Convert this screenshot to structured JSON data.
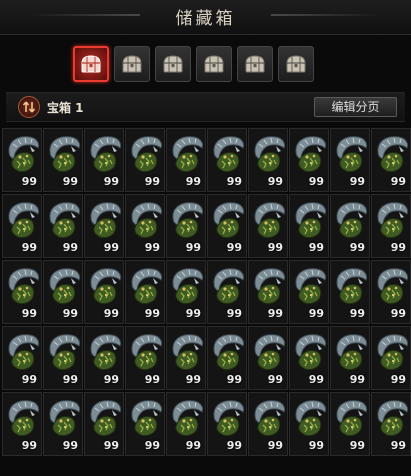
{
  "window": {
    "title": "储藏箱"
  },
  "tabs": [
    {
      "icon": "chest-icon",
      "active": true
    },
    {
      "icon": "chest-icon",
      "active": false
    },
    {
      "icon": "chest-icon",
      "active": false
    },
    {
      "icon": "chest-icon",
      "active": false
    },
    {
      "icon": "chest-icon",
      "active": false
    },
    {
      "icon": "chest-icon",
      "active": false
    }
  ],
  "bar": {
    "sort_icon": "sort-arrows-icon",
    "page_label": "宝箱 1",
    "edit_button": "编辑分页"
  },
  "grid": {
    "columns": 10,
    "rows": 5,
    "item_icon": "monster-head-icon",
    "quantities": [
      "99",
      "99",
      "99",
      "99",
      "99",
      "99",
      "99",
      "99",
      "99",
      "99",
      "99",
      "99",
      "99",
      "99",
      "99",
      "99",
      "99",
      "99",
      "99",
      "99",
      "99",
      "99",
      "99",
      "99",
      "99",
      "99",
      "99",
      "99",
      "99",
      "99",
      "99",
      "99",
      "99",
      "99",
      "99",
      "99",
      "99",
      "99",
      "99",
      "99",
      "99",
      "99",
      "99",
      "99",
      "99",
      "99",
      "99",
      "99",
      "99",
      "99"
    ]
  },
  "colors": {
    "accent_red": "#ea3a30",
    "background": "#0a0a0a",
    "text": "#e8e1d2"
  }
}
